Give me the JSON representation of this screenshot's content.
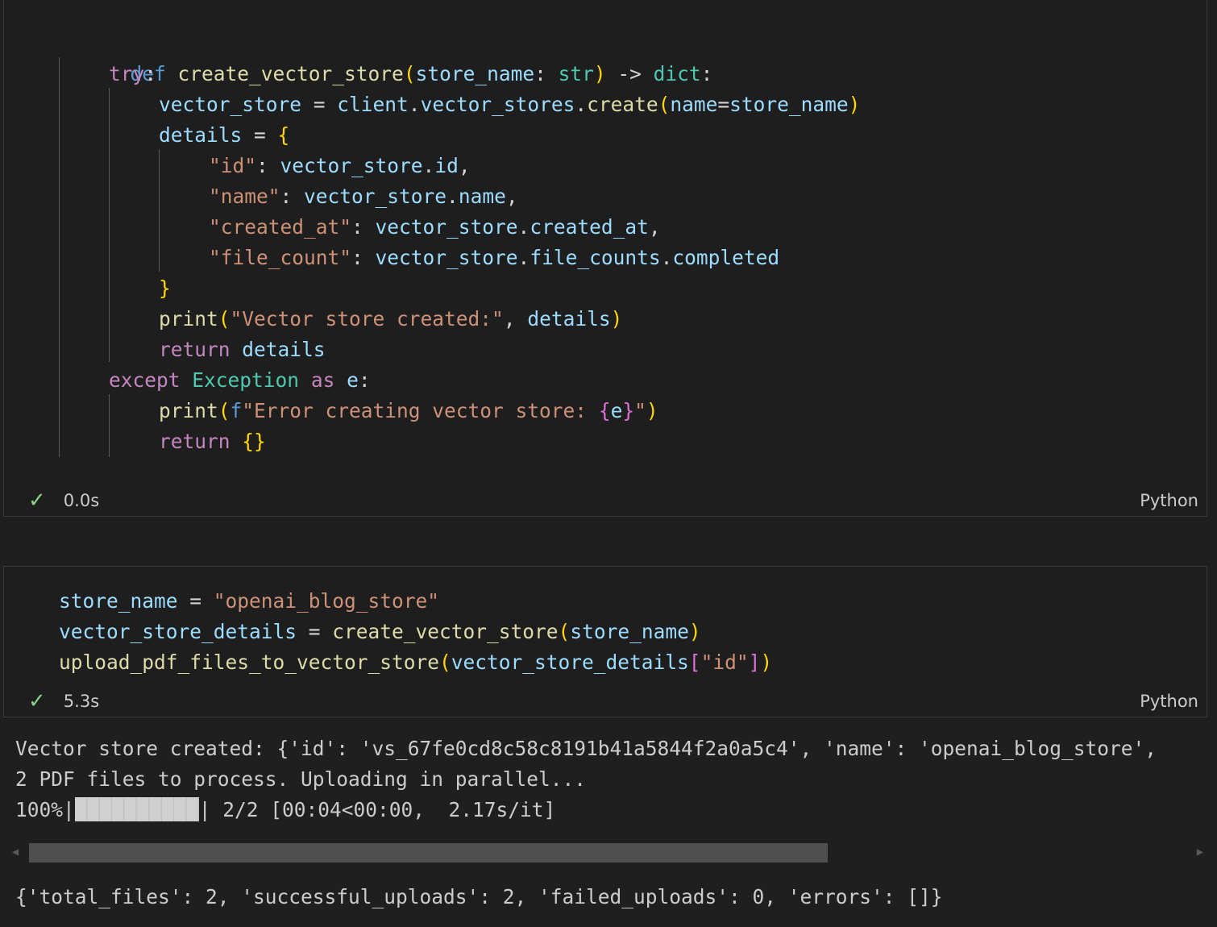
{
  "cell1": {
    "lines": [
      "def create_vector_store(store_name: str) -> dict:",
      "    try:",
      "        vector_store = client.vector_stores.create(name=store_name)",
      "        details = {",
      "            \"id\": vector_store.id,",
      "            \"name\": vector_store.name,",
      "            \"created_at\": vector_store.created_at,",
      "            \"file_count\": vector_store.file_counts.completed",
      "        }",
      "        print(\"Vector store created:\", details)",
      "        return details",
      "    except Exception as e:",
      "        print(f\"Error creating vector store: {e}\")",
      "        return {}"
    ],
    "exec_time": "0.0s",
    "language": "Python"
  },
  "cell2": {
    "lines": [
      "store_name = \"openai_blog_store\"",
      "vector_store_details = create_vector_store(store_name)",
      "upload_pdf_files_to_vector_store(vector_store_details[\"id\"])"
    ],
    "exec_time": "5.3s",
    "language": "Python"
  },
  "output": {
    "line1": "Vector store created: {'id': 'vs_67fe0cd8c58c8191b41a5844f2a0a5c4', 'name': 'openai_blog_store',",
    "line2": "2 PDF files to process. Uploading in parallel...",
    "progress_prefix": "100%|",
    "progress_fraction": 1.0,
    "progress_suffix": "| 2/2 [00:04<00:00,  2.17s/it]",
    "result": "{'total_files': 2, 'successful_uploads': 2, 'failed_uploads': 0, 'errors': []}"
  },
  "colors": {
    "keyword": "#569cd6",
    "control": "#c586c0",
    "function": "#dcdcaa",
    "variable": "#9cdcfe",
    "type": "#4ec9b0",
    "string": "#ce9178",
    "success_check": "#89d185"
  },
  "icons": {
    "status": "check-icon",
    "scroll_left": "chevron-left-icon",
    "scroll_right": "chevron-right-icon"
  }
}
